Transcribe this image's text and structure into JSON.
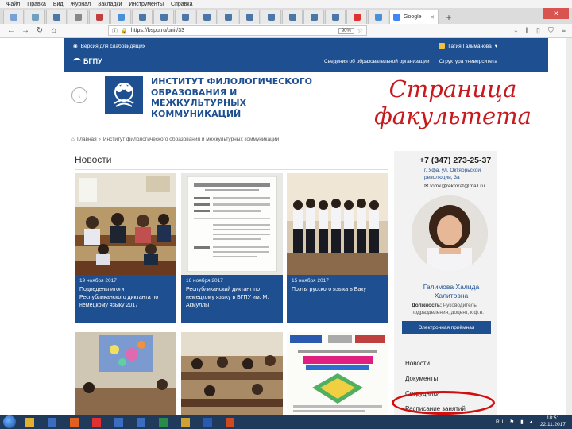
{
  "menubar": {
    "items": [
      "Файл",
      "Правка",
      "Вид",
      "Журнал",
      "Закладки",
      "Инструменты",
      "Справка"
    ]
  },
  "browser": {
    "tabs": [
      {
        "icon": "page-icon",
        "color": "#7aa0d8"
      },
      {
        "icon": "globe-icon",
        "color": "#6fa0c0"
      },
      {
        "icon": "vk-icon",
        "color": "#4a76a8"
      },
      {
        "icon": "page-icon",
        "color": "#888888"
      },
      {
        "icon": "page-icon",
        "color": "#c04040"
      },
      {
        "icon": "page-icon",
        "color": "#4a90d9"
      },
      {
        "icon": "vk-icon",
        "color": "#4a76a8"
      },
      {
        "icon": "vk-icon",
        "color": "#4a76a8"
      },
      {
        "icon": "vk-icon",
        "color": "#4a76a8"
      },
      {
        "icon": "vk-icon",
        "color": "#4a76a8"
      },
      {
        "icon": "vk-icon",
        "color": "#4a76a8"
      },
      {
        "icon": "vk-icon",
        "color": "#4a76a8"
      },
      {
        "icon": "vk-icon",
        "color": "#4a76a8"
      },
      {
        "icon": "vk-icon",
        "color": "#4a76a8"
      },
      {
        "icon": "vk-icon",
        "color": "#4a76a8"
      },
      {
        "icon": "vk-icon",
        "color": "#4a76a8"
      },
      {
        "icon": "yandex-icon",
        "color": "#e03030"
      },
      {
        "icon": "page-icon",
        "color": "#4a90d9"
      }
    ],
    "google_tab_label": "Google",
    "url": "https://bspu.ru/unit/33",
    "zoom": "90%"
  },
  "site": {
    "visually_impaired": "Версия для слабовидящих",
    "user_name": "Гагия Гальманова",
    "logo_text": "БГПУ",
    "nav": [
      "Сведения об образовательной организации",
      "Структура университета"
    ],
    "institute_title": "ИНСТИТУТ ФИЛОЛОГИЧЕСКОГО ОБРАЗОВАНИЯ И МЕЖКУЛЬТУРНЫХ КОММУНИКАЦИЙ",
    "overlay_caption": "Страница факультета",
    "breadcrumb": {
      "home": "Главная",
      "current": "Институт филологического образования и межкультурных коммуникаций"
    }
  },
  "news": {
    "heading": "Новости",
    "items": [
      {
        "date": "19 ноября 2017",
        "text": "Подведены итоги Республиканского диктанта по немецкому языку 2017"
      },
      {
        "date": "16 ноября 2017",
        "text": "Республиканский диктант по немецкому языку в БГПУ им. М. Акмуллы"
      },
      {
        "date": "15 ноября 2017",
        "text": "Поэты русского языка в Баку"
      }
    ]
  },
  "sidebar": {
    "phone": "+7 (347) 273-25-37",
    "address": "г. Уфа, ул. Октябрьской революции, 3а",
    "email": "fomk@rektorat@mail.ru",
    "dean_name": "Галимова Халида Халитовна",
    "dean_position_label": "Должность:",
    "dean_position": "Руководитель подразделения, доцент, к.ф.н.",
    "reception": "Электронная приёмная",
    "menu": [
      "Новости",
      "Документы",
      "Сотрудники",
      "Расписание занятий"
    ]
  },
  "taskbar": {
    "apps": [
      {
        "icon": "explorer-icon",
        "color": "#e0b030"
      },
      {
        "icon": "d-app-icon",
        "color": "#3a6cc0"
      },
      {
        "icon": "firefox-icon",
        "color": "#e06020"
      },
      {
        "icon": "yandex-icon",
        "color": "#e03030"
      },
      {
        "icon": "d-app-icon",
        "color": "#3a6cc0"
      },
      {
        "icon": "d-app-icon",
        "color": "#3a6cc0"
      },
      {
        "icon": "excel-icon",
        "color": "#2a8a4a"
      },
      {
        "icon": "folder-icon",
        "color": "#d0a030"
      },
      {
        "icon": "word-icon",
        "color": "#2a5ab0"
      },
      {
        "icon": "powerpoint-icon",
        "color": "#d04a20"
      }
    ],
    "lang": "RU",
    "time": "18:51",
    "date": "22.11.2017"
  },
  "colors": {
    "brand_blue": "#1d4f91",
    "accent_red": "#c8191e"
  }
}
